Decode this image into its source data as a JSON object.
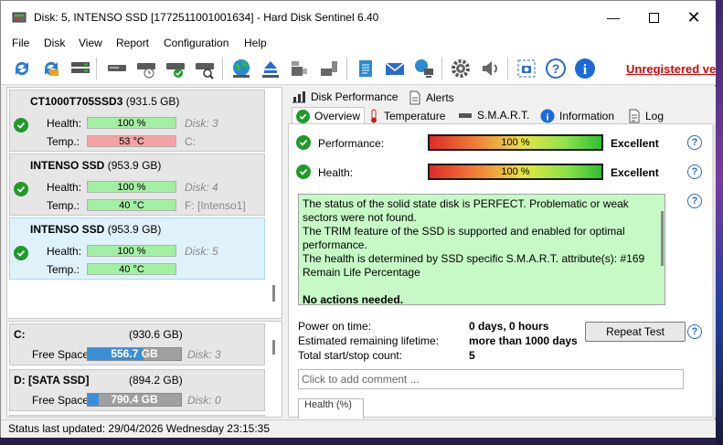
{
  "window": {
    "title": "Disk: 5, INTENSO SSD [1772511001001634]  -  Hard Disk Sentinel 6.40",
    "controls": [
      "minimize",
      "maximize",
      "close"
    ]
  },
  "menu": [
    "File",
    "Disk",
    "View",
    "Report",
    "Configuration",
    "Help"
  ],
  "toolbar": {
    "icons": [
      "refresh-icon",
      "refresh-all-icon",
      "disk-list-icon",
      "disk-info-icon",
      "disk-schedule-icon",
      "disk-ok-icon",
      "disk-search-icon",
      "globe-icon",
      "eject-icon",
      "usb-drive-icon",
      "usb-plug-icon",
      "notepad-icon",
      "mail-icon",
      "network-icon",
      "settings-icon",
      "speaker-icon",
      "screenshot-icon",
      "help-icon",
      "info-icon"
    ],
    "unregistered_label": "Unregistered ve"
  },
  "disks": [
    {
      "name": "CT1000T705SSD3",
      "size": "(931.5 GB)",
      "health_label": "Health:",
      "health": "100 %",
      "temp_label": "Temp.:",
      "temp": "53 °C",
      "temp_status": "hot",
      "disk_no": "Disk: 3",
      "drive": "C:"
    },
    {
      "name": "INTENSO SSD",
      "size": "(953.9 GB)",
      "health_label": "Health:",
      "health": "100 %",
      "temp_label": "Temp.:",
      "temp": "40 °C",
      "temp_status": "ok",
      "disk_no": "Disk: 4",
      "drive": "F: [Intenso1]"
    },
    {
      "name": "INTENSO SSD",
      "size": "(953.9 GB)",
      "health_label": "Health:",
      "health": "100 %",
      "temp_label": "Temp.:",
      "temp": "40 °C",
      "temp_status": "ok",
      "disk_no": "Disk: 5",
      "drive": ""
    }
  ],
  "volumes": [
    {
      "name": "C:",
      "size": "(930.6 GB)",
      "free_label": "Free Space",
      "free": "556.7 GB",
      "used_fraction": 0.4,
      "disk_no": "Disk: 3"
    },
    {
      "name": "D: [SATA SSD]",
      "size": "(894.2 GB)",
      "free_label": "Free Space",
      "free": "790.4 GB",
      "used_fraction": 0.12,
      "disk_no": "Disk: 0"
    }
  ],
  "tabs_top": [
    "Disk Performance",
    "Alerts"
  ],
  "tabs": [
    "Overview",
    "Temperature",
    "S.M.A.R.T.",
    "Information",
    "Log"
  ],
  "overview": {
    "performance_label": "Performance:",
    "performance_value": "100 %",
    "performance_fraction": 1.0,
    "performance_rating": "Excellent",
    "health_label": "Health:",
    "health_value": "100 %",
    "health_fraction": 1.0,
    "health_rating": "Excellent",
    "status_lines": [
      "The status of the solid state disk is PERFECT. Problematic or weak sectors were not found.",
      "The TRIM feature of the SSD is supported and enabled for optimal performance.",
      "The health is determined by SSD specific S.M.A.R.T. attribute(s):  #169 Remain Life Percentage"
    ],
    "status_action": "No actions needed.",
    "power_on_label": "Power on time:",
    "power_on_value": "0 days, 0 hours",
    "lifetime_label": "Estimated remaining lifetime:",
    "lifetime_value": "more than 1000 days",
    "startstop_label": "Total start/stop count:",
    "startstop_value": "5",
    "repeat_test": "Repeat Test",
    "comment_placeholder": "Click to add comment ...",
    "partial_panel": "Health (%)"
  },
  "status_bar": "Status last updated: 29/04/2026 Wednesday 23:15:35",
  "colors": {
    "accent_blue": "#3a8fd8",
    "health_green": "#a2f0a2",
    "temp_red": "#f4a2a2",
    "status_green": "#c6f9c6",
    "unregistered_red": "#e00000"
  }
}
